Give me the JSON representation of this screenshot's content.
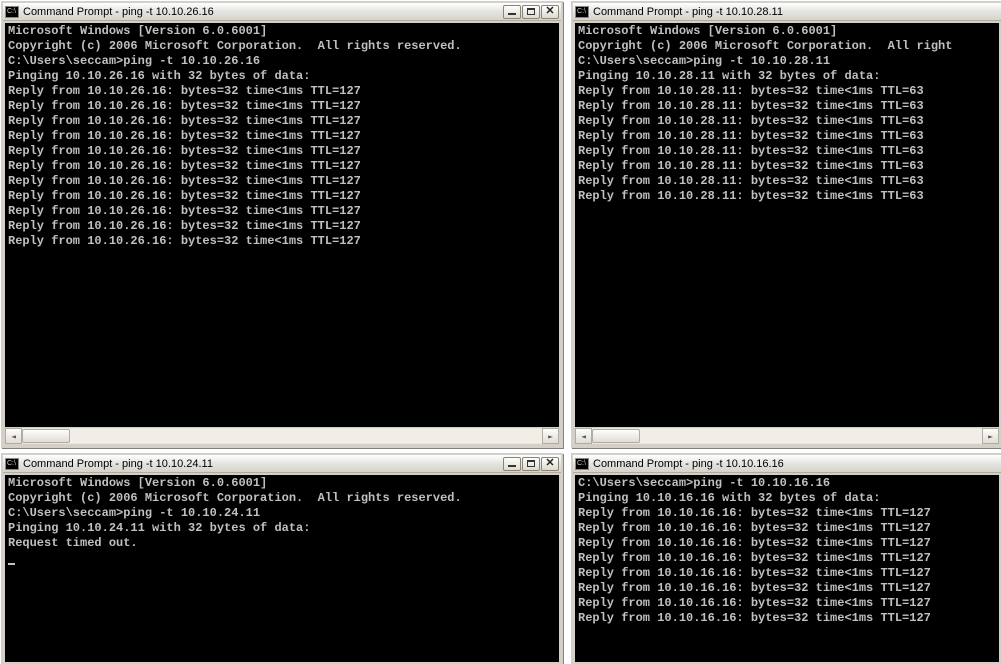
{
  "windows": [
    {
      "id": "w1",
      "title": "Command Prompt - ping  -t 10.10.26.16",
      "icon_label": "C:\\",
      "show_controls": true,
      "show_scrollbar": true,
      "header_lines": [
        "Microsoft Windows [Version 6.0.6001]",
        "Copyright (c) 2006 Microsoft Corporation.  All rights reserved.",
        "",
        "C:\\Users\\seccam>ping -t 10.10.26.16",
        "",
        "Pinging 10.10.26.16 with 32 bytes of data:"
      ],
      "reply_ip": "10.10.26.16",
      "reply_bytes": 32,
      "reply_time": "<1ms",
      "reply_ttl": 127,
      "reply_count": 11,
      "extra_lines": [],
      "show_cursor": false
    },
    {
      "id": "w2",
      "title": "Command Prompt - ping  -t 10.10.28.11",
      "icon_label": "C:\\",
      "show_controls": false,
      "show_scrollbar": true,
      "header_lines": [
        "Microsoft Windows [Version 6.0.6001]",
        "Copyright (c) 2006 Microsoft Corporation.  All right",
        "",
        "C:\\Users\\seccam>ping -t 10.10.28.11",
        "",
        "Pinging 10.10.28.11 with 32 bytes of data:"
      ],
      "reply_ip": "10.10.28.11",
      "reply_bytes": 32,
      "reply_time": "<1ms",
      "reply_ttl": 63,
      "reply_count": 8,
      "extra_lines": [],
      "show_cursor": false
    },
    {
      "id": "w3",
      "title": "Command Prompt - ping  -t 10.10.24.11",
      "icon_label": "C:\\",
      "show_controls": true,
      "show_scrollbar": false,
      "header_lines": [
        "Microsoft Windows [Version 6.0.6001]",
        "Copyright (c) 2006 Microsoft Corporation.  All rights reserved.",
        "",
        "C:\\Users\\seccam>ping -t 10.10.24.11",
        "",
        "Pinging 10.10.24.11 with 32 bytes of data:"
      ],
      "reply_ip": "",
      "reply_bytes": 0,
      "reply_time": "",
      "reply_ttl": 0,
      "reply_count": 0,
      "extra_lines": [
        "Request timed out."
      ],
      "show_cursor": true
    },
    {
      "id": "w4",
      "title": "Command Prompt - ping  -t 10.10.16.16",
      "icon_label": "C:\\",
      "show_controls": false,
      "show_scrollbar": false,
      "header_lines": [
        "",
        "C:\\Users\\seccam>ping -t 10.10.16.16",
        "",
        "Pinging 10.10.16.16 with 32 bytes of data:"
      ],
      "reply_ip": "10.10.16.16",
      "reply_bytes": 32,
      "reply_time": "<1ms",
      "reply_ttl": 127,
      "reply_count": 8,
      "extra_lines": [],
      "show_cursor": false
    }
  ]
}
